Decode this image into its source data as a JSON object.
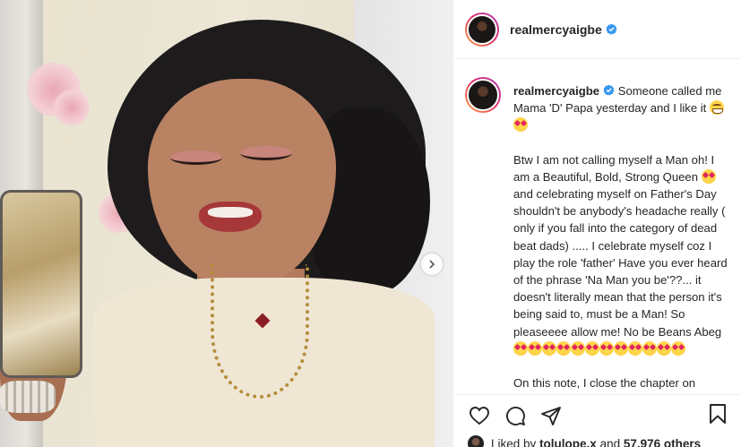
{
  "post": {
    "username": "realmercyaigbe",
    "verified": true
  },
  "caption": {
    "username": "realmercyaigbe",
    "para1_text": "Someone called me Mama 'D' Papa yesterday and I like it",
    "para1_emojis": [
      "grinning-face",
      "heart-eyes-face"
    ],
    "para2_text_a": "Btw I am not calling myself a Man oh! I am a Beautiful, Bold, Strong Queen",
    "para2_text_b": "and celebrating myself on Father's Day shouldn't be anybody's headache really ( only if you fall into the category of dead beat dads) ..... I celebrate myself coz I play the role 'father' Have you ever heard of the phrase 'Na Man you be'??... it doesn't literally mean that the person it's being said to, must be a Man! So pleaseeee allow me! No be Beans Abeg",
    "para2_trailing_emoji_count": 12,
    "para3_text": "On this note, I close the chapter on"
  },
  "actions": {
    "like": "heart-outline-icon",
    "comment": "comment-bubble-icon",
    "share": "paper-plane-icon",
    "save": "bookmark-icon"
  },
  "likes": {
    "prefix": "Liked by",
    "user": "tolulope.x",
    "middle": "and",
    "count": "57,976 others"
  },
  "colors": {
    "text": "#262626",
    "verified_blue": "#3897f0",
    "story_ring": [
      "#f9a23b",
      "#e1306c",
      "#a53bb3"
    ],
    "divider": "#efefef"
  }
}
